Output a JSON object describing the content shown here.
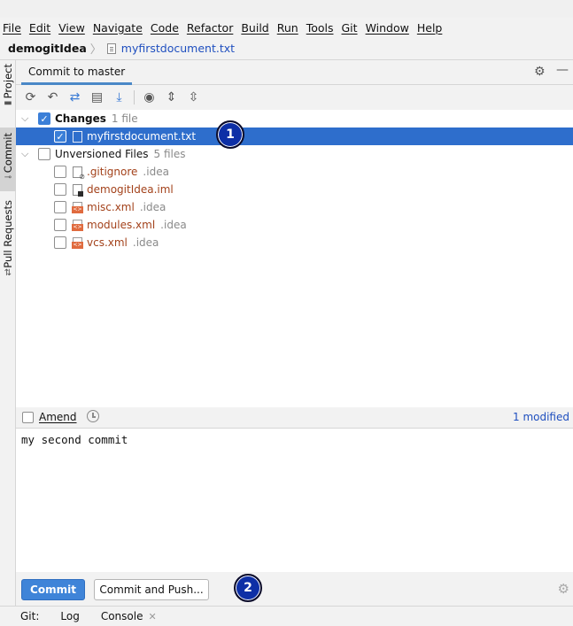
{
  "menu": [
    "File",
    "Edit",
    "View",
    "Navigate",
    "Code",
    "Refactor",
    "Build",
    "Run",
    "Tools",
    "Git",
    "Window",
    "Help"
  ],
  "navbar": {
    "project": "demogitIdea",
    "file": "myfirstdocument.txt"
  },
  "stripe": {
    "project": "Project",
    "commit": "Commit",
    "pull_requests": "Pull Requests"
  },
  "panel": {
    "tab": "Commit to master"
  },
  "toolbar": {
    "icons": [
      "refresh-icon",
      "rollback-icon",
      "diff-icon",
      "shelve-icon",
      "update-icon",
      "eye-icon",
      "expand-all-icon",
      "collapse-all-icon"
    ]
  },
  "changes": {
    "label": "Changes",
    "count": "1 file",
    "checked": true,
    "files": [
      {
        "name": "myfirstdocument.txt",
        "checked": true,
        "selected": true
      }
    ]
  },
  "unversioned": {
    "label": "Unversioned Files",
    "count": "5 files",
    "checked": false,
    "files": [
      {
        "name": ".gitignore",
        "path": ".idea",
        "icon": "gitignore-file-icon"
      },
      {
        "name": "demogitIdea.iml",
        "path": "",
        "icon": "iml-file-icon"
      },
      {
        "name": "misc.xml",
        "path": ".idea",
        "icon": "xml-file-icon"
      },
      {
        "name": "modules.xml",
        "path": ".idea",
        "icon": "xml-file-icon"
      },
      {
        "name": "vcs.xml",
        "path": ".idea",
        "icon": "xml-file-icon"
      }
    ]
  },
  "badges": {
    "one": "1",
    "two": "2"
  },
  "amend": {
    "label": "Amend",
    "checked": false,
    "modified": "1 modified"
  },
  "commit_message": "my second commit",
  "buttons": {
    "commit": "Commit",
    "commit_push": "Commit and Push..."
  },
  "status": {
    "git": "Git:",
    "log": "Log",
    "console": "Console"
  },
  "colors": {
    "selection": "#2e6ecc",
    "accent": "#3f84d8",
    "badge": "#0d2fa6",
    "unversioned": "#a3421b"
  }
}
